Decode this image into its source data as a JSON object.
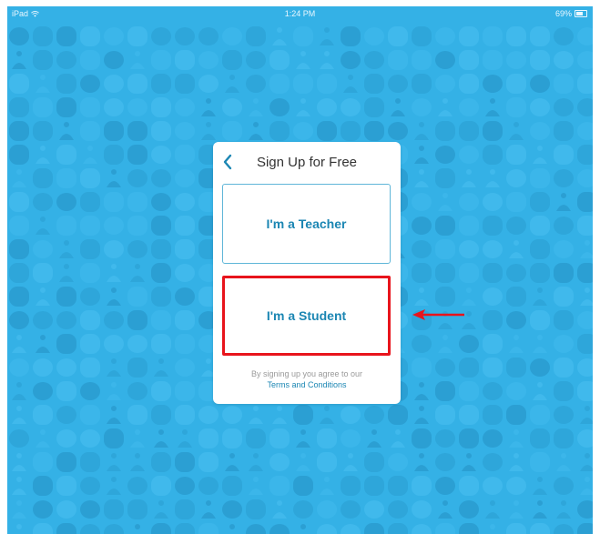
{
  "status_bar": {
    "device": "iPad",
    "time": "1:24 PM",
    "battery": "69%",
    "battery_level": 0.69
  },
  "dialog": {
    "title": "Sign Up for Free",
    "back_icon": "chevron-left-icon",
    "options": [
      {
        "label": "I'm a Teacher"
      },
      {
        "label": "I'm a Student",
        "highlighted": true
      }
    ],
    "terms_text": "By signing up you agree to our",
    "terms_link": "Terms and Conditions"
  },
  "annotation": {
    "arrow_icon": "arrow-left-icon",
    "color": "#e8141c"
  },
  "colors": {
    "background": "#34b1e6",
    "accent": "#1b86b3",
    "highlight": "#e8141c"
  }
}
